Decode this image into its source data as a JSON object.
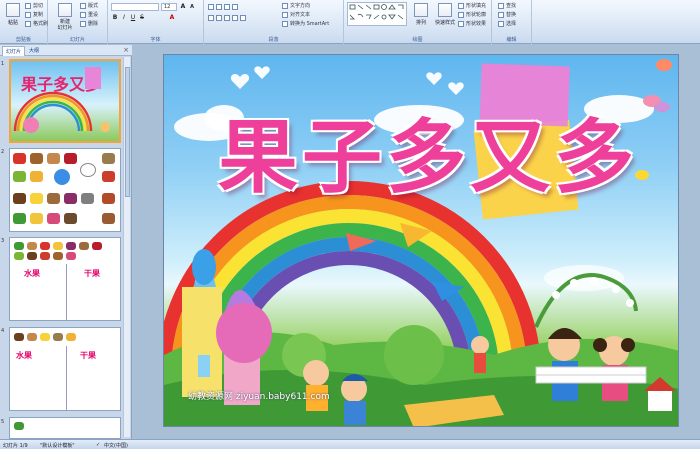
{
  "ribbon": {
    "groups": [
      {
        "label": "剪贴板"
      },
      {
        "label": "幻灯片"
      },
      {
        "label": "字体"
      },
      {
        "label": "段落"
      },
      {
        "label": "绘图"
      },
      {
        "label": "编辑"
      }
    ],
    "clipboard": {
      "paste": "粘贴",
      "cut": "剪切",
      "copy": "复制",
      "format_painter": "格式刷"
    },
    "slides": {
      "new_slide": "新建\n幻灯片",
      "layout": "版式",
      "reset": "重设",
      "delete": "删除"
    },
    "font": {
      "size": "12"
    },
    "paragraph": {
      "text_direction": "文字方向",
      "align_text": "对齐文本",
      "smartart": "转换为 SmartArt"
    },
    "drawing": {
      "arrange": "排列",
      "quick_styles": "快速样式",
      "shape_fill": "形状填充",
      "shape_outline": "形状轮廓",
      "shape_effects": "形状效果"
    },
    "editing": {
      "find": "查找",
      "replace": "替换",
      "select": "选择"
    }
  },
  "left_panel": {
    "tab_slides": "幻灯片",
    "tab_outline": "大纲",
    "slides": [
      {
        "num": "1",
        "title": "果子多又多"
      },
      {
        "num": "2"
      },
      {
        "num": "3",
        "label_left": "水果",
        "label_right": "干果"
      },
      {
        "num": "4",
        "label_left": "水果",
        "label_right": "干果"
      },
      {
        "num": "5"
      }
    ]
  },
  "slide": {
    "title": "果子多又多",
    "watermark": "幼教资源网 ziyuan.baby611.com"
  },
  "status": {
    "slide_count": "幻灯片 1/9",
    "theme": "\"默认设计模板\"",
    "language": "中文(中国)"
  },
  "colors": {
    "title_pink": "#ee3f9a",
    "ribbon_bg": "#dbe7f5",
    "selection": "#f2a53a"
  }
}
